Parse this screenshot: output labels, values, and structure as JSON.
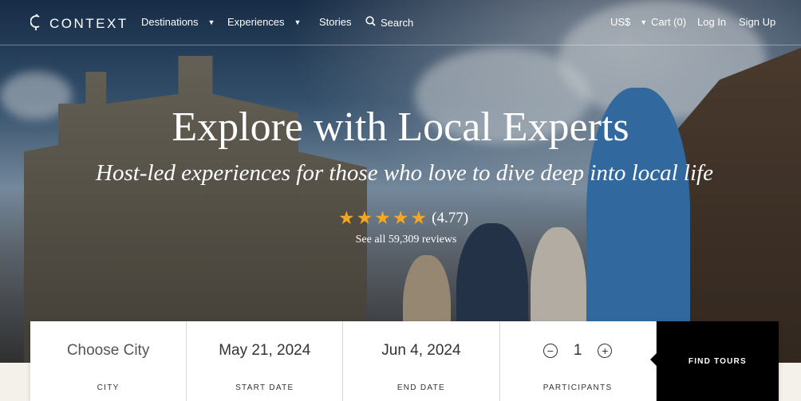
{
  "brand": {
    "name": "CONTEXT"
  },
  "nav": {
    "destinations": "Destinations",
    "experiences": "Experiences",
    "stories": "Stories",
    "search": "Search",
    "currency": "US$",
    "cart": "Cart (0)",
    "login": "Log In",
    "signup": "Sign Up"
  },
  "hero": {
    "headline": "Explore with Local Experts",
    "subheadline": "Host-led experiences for those who love to dive deep into local life",
    "rating": {
      "stars": 5,
      "value": "(4.77)"
    },
    "reviews_link": "See all 59,309 reviews"
  },
  "search_form": {
    "city": {
      "value": "Choose City",
      "label": "CITY"
    },
    "start_date": {
      "value": "May 21, 2024",
      "label": "START DATE"
    },
    "end_date": {
      "value": "Jun 4, 2024",
      "label": "END DATE"
    },
    "participants": {
      "value": "1",
      "label": "PARTICIPANTS",
      "minus": "−",
      "plus": "+"
    },
    "submit": "FIND TOURS"
  },
  "colors": {
    "star": "#f5a623",
    "button_bg": "#000000",
    "bar_bg": "#ffffff"
  }
}
